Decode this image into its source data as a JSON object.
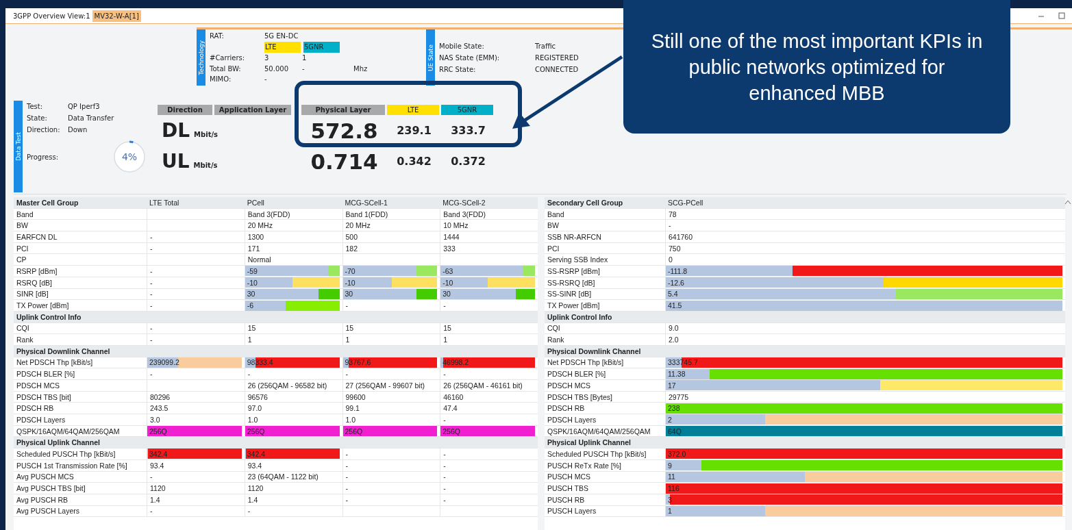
{
  "tabs": [
    {
      "label": "3GPP Overview View:1",
      "selected": false
    },
    {
      "label": "MV32-W-A[1]",
      "selected": true
    }
  ],
  "technology": {
    "title": "Technology",
    "rat_label": "RAT:",
    "rat": "5G EN-DC",
    "badges": [
      {
        "label": "LTE",
        "color": "#ffe000"
      },
      {
        "label": "5GNR",
        "color": "#00b0c8"
      }
    ],
    "rows": [
      {
        "label": "#Carriers:",
        "values": [
          "3",
          "1"
        ]
      },
      {
        "label": "Total BW:",
        "values": [
          "50.000",
          "-",
          "Mhz"
        ]
      },
      {
        "label": "MIMO:",
        "values": [
          "-"
        ]
      }
    ]
  },
  "ue_state": {
    "title": "UE State",
    "rows": [
      {
        "label": "Mobile State:",
        "value": "Traffic"
      },
      {
        "label": "NAS State (EMM):",
        "value": "REGISTERED"
      },
      {
        "label": "RRC State:",
        "value": "CONNECTED"
      }
    ]
  },
  "data_test": {
    "title": "Data Test",
    "rows": [
      {
        "label": "Test:",
        "value": "QP Iperf3"
      },
      {
        "label": "State:",
        "value": "Data Transfer"
      },
      {
        "label": "Direction:",
        "value": "Down"
      }
    ],
    "progress_label": "Progress:",
    "progress": {
      "text": "4%",
      "level": 0.04
    }
  },
  "throughput": {
    "columns": [
      {
        "label": "Direction",
        "color": "#a8a8a8"
      },
      {
        "label": "Application Layer",
        "color": "#a8a8a8"
      },
      {
        "label": "Physical Layer",
        "color": "#a8a8a8"
      },
      {
        "label": "LTE",
        "color": "#ffe000"
      },
      {
        "label": "5GNR",
        "color": "#00b0c8"
      }
    ],
    "rows": [
      {
        "direction": "DL",
        "unit": "Mbit/s",
        "physical": "572.8",
        "lte": "239.1",
        "nr": "333.7"
      },
      {
        "direction": "UL",
        "unit": "Mbit/s",
        "physical": "0.714",
        "lte": "0.342",
        "nr": "0.372"
      }
    ]
  },
  "master_table": {
    "columns": [
      "Master Cell Group",
      "LTE Total",
      "PCell",
      "MCG-SCell-1",
      "MCG-SCell-2"
    ],
    "rows": [
      {
        "kind": "row",
        "label": "Band",
        "cells": [
          null,
          "Band 3(FDD)",
          "Band 1(FDD)",
          "Band 3(FDD)"
        ]
      },
      {
        "kind": "row",
        "label": "BW",
        "cells": [
          null,
          "20 MHz",
          "20 MHz",
          "10 MHz"
        ]
      },
      {
        "kind": "row",
        "label": "EARFCN DL",
        "cells": [
          "-",
          "1300",
          "500",
          "1444"
        ]
      },
      {
        "kind": "row",
        "label": "PCI",
        "cells": [
          "-",
          "171",
          "182",
          "333"
        ]
      },
      {
        "kind": "row",
        "label": "CP",
        "cells": [
          null,
          "Normal",
          null,
          null
        ]
      },
      {
        "kind": "row",
        "label": "RSRP [dBm]",
        "cells": [
          "-",
          {
            "text": "-59",
            "level": 0.88,
            "color": "#99e860"
          },
          {
            "text": "-70",
            "level": 0.78,
            "color": "#99e860"
          },
          {
            "text": "-63",
            "level": 0.87,
            "color": "#99e860"
          }
        ]
      },
      {
        "kind": "row",
        "label": "RSRQ [dB]",
        "cells": [
          "-",
          {
            "text": "-10",
            "level": 0.5,
            "color": "#fde060"
          },
          {
            "text": "-10",
            "level": 0.52,
            "color": "#fde060"
          },
          {
            "text": "-10",
            "level": 0.5,
            "color": "#fde060"
          }
        ]
      },
      {
        "kind": "row",
        "label": "SINR [dB]",
        "cells": [
          "-",
          {
            "text": "30",
            "level": 0.78,
            "color": "#44cc00"
          },
          {
            "text": "30",
            "level": 0.78,
            "color": "#44cc00"
          },
          {
            "text": "30",
            "level": 0.8,
            "color": "#44cc00"
          }
        ]
      },
      {
        "kind": "row",
        "label": "TX Power [dBm]",
        "cells": [
          "-",
          {
            "text": "-6",
            "level": 0.43,
            "color": "#88ee00"
          },
          "-",
          "-"
        ]
      },
      {
        "kind": "section",
        "label": "Uplink Control Info"
      },
      {
        "kind": "row",
        "label": "CQI",
        "cells": [
          "-",
          "15",
          "15",
          "15"
        ]
      },
      {
        "kind": "row",
        "label": "Rank",
        "cells": [
          "-",
          "1",
          "1",
          "1"
        ]
      },
      {
        "kind": "section",
        "label": "Physical Downlink Channel"
      },
      {
        "kind": "row",
        "label": "Net PDSCH Thp [kBit/s]",
        "cells": [
          {
            "text": "239099.2",
            "level": 0.33,
            "color": "#f8cc9c"
          },
          {
            "text": "98333.4",
            "level": 0.11,
            "color": "#f01818"
          },
          {
            "text": "93767.6",
            "level": 0.06,
            "color": "#f01818"
          },
          {
            "text": "46998.2",
            "level": 0.03,
            "color": "#f01818"
          }
        ]
      },
      {
        "kind": "row",
        "label": "PDSCH BLER [%]",
        "cells": [
          "-",
          "-",
          "-",
          "-"
        ]
      },
      {
        "kind": "row",
        "label": "PDSCH MCS",
        "cells": [
          null,
          "26 (256QAM - 96582 bit)",
          "27 (256QAM - 99607 bit)",
          "26 (256QAM - 46161 bit)"
        ]
      },
      {
        "kind": "row",
        "label": "PDSCH TBS [bit]",
        "cells": [
          "80296",
          "96576",
          "99600",
          "46160"
        ]
      },
      {
        "kind": "row",
        "label": "PDSCH RB",
        "cells": [
          "243.5",
          "97.0",
          "99.1",
          "47.4"
        ]
      },
      {
        "kind": "row",
        "label": "PDSCH Layers",
        "cells": [
          "3.0",
          "1.0",
          "1.0",
          "-"
        ]
      },
      {
        "kind": "row",
        "label": "QSPK/16AQM/64QAM/256QAM",
        "cells": [
          {
            "text": "256Q",
            "color": "#f020d0"
          },
          {
            "text": "256Q",
            "color": "#f020d0"
          },
          {
            "text": "256Q",
            "color": "#f020d0"
          },
          {
            "text": "256Q",
            "color": "#f020d0"
          }
        ]
      },
      {
        "kind": "section",
        "label": "Physical Uplink Channel"
      },
      {
        "kind": "row",
        "label": "Scheduled PUSCH Thp [kBit/s]",
        "cells": [
          {
            "text": "342.4",
            "level": 0.01,
            "color": "#f01818"
          },
          {
            "text": "342.4",
            "level": 0.01,
            "color": "#f01818"
          },
          "-",
          "-"
        ]
      },
      {
        "kind": "row",
        "label": "PUSCH 1st Transmission Rate [%]",
        "cells": [
          "93.4",
          "93.4",
          "-",
          "-"
        ]
      },
      {
        "kind": "row",
        "label": "Avg PUSCH MCS",
        "cells": [
          "-",
          "23 (64QAM - 1122 bit)",
          "-",
          "-"
        ]
      },
      {
        "kind": "row",
        "label": "Avg PUSCH TBS [bit]",
        "cells": [
          "1120",
          "1120",
          "-",
          "-"
        ]
      },
      {
        "kind": "row",
        "label": "Avg PUSCH RB",
        "cells": [
          "1.4",
          "1.4",
          "-",
          "-"
        ]
      },
      {
        "kind": "row",
        "label": "Avg PUSCH Layers",
        "cells": [
          "-",
          "-",
          null,
          null
        ]
      }
    ]
  },
  "secondary_table": {
    "columns": [
      "Secondary Cell Group",
      "SCG-PCell"
    ],
    "rows": [
      {
        "kind": "row",
        "label": "Band",
        "cells": [
          "78"
        ]
      },
      {
        "kind": "row",
        "label": "BW",
        "cells": [
          "-"
        ]
      },
      {
        "kind": "row",
        "label": "SSB NR-ARFCN",
        "cells": [
          "641760"
        ]
      },
      {
        "kind": "row",
        "label": "PCI",
        "cells": [
          "750"
        ]
      },
      {
        "kind": "row",
        "label": "Serving SSB Index",
        "cells": [
          "0"
        ]
      },
      {
        "kind": "row",
        "label": "SS-RSRP [dBm]",
        "cells": [
          {
            "text": "-111.8",
            "level": 0.32,
            "color": "#f01818"
          }
        ]
      },
      {
        "kind": "row",
        "label": "SS-RSRQ [dB]",
        "cells": [
          {
            "text": "-12.6",
            "level": 0.55,
            "color": "#ffd800"
          }
        ]
      },
      {
        "kind": "row",
        "label": "SS-SINR [dB]",
        "cells": [
          {
            "text": "5.4",
            "level": 0.58,
            "color": "#99e860"
          }
        ]
      },
      {
        "kind": "row",
        "label": "TX Power [dBm]",
        "cells": [
          {
            "text": "41.5",
            "color": "#b4c6e0"
          }
        ]
      },
      {
        "kind": "section",
        "label": "Uplink Control Info"
      },
      {
        "kind": "row",
        "label": "CQI",
        "cells": [
          "9.0"
        ]
      },
      {
        "kind": "row",
        "label": "Rank",
        "cells": [
          "2.0"
        ]
      },
      {
        "kind": "section",
        "label": "Physical Downlink Channel"
      },
      {
        "kind": "row",
        "label": "Net PDSCH Thp [kBit/s]",
        "cells": [
          {
            "text": "333745.7",
            "level": 0.04,
            "color": "#f01818"
          }
        ]
      },
      {
        "kind": "row",
        "label": "PDSCH BLER [%]",
        "cells": [
          {
            "text": "11.38",
            "level": 0.11,
            "color": "#66e000"
          }
        ]
      },
      {
        "kind": "row",
        "label": "PDSCH MCS",
        "cells": [
          {
            "text": "17",
            "level": 0.54,
            "color": "#fde868"
          }
        ]
      },
      {
        "kind": "row",
        "label": "PDSCH TBS [Bytes]",
        "cells": [
          "29775"
        ]
      },
      {
        "kind": "row",
        "label": "PDSCH RB",
        "cells": [
          {
            "text": "238",
            "color": "#66e000"
          }
        ]
      },
      {
        "kind": "row",
        "label": "PDSCH Layers",
        "cells": [
          {
            "text": "2",
            "level": 0.25,
            "color": "#f8cc9c"
          }
        ]
      },
      {
        "kind": "row",
        "label": "QSPK/16AQM/64QAM/256QAM",
        "cells": [
          {
            "text": "64Q",
            "color": "#008098"
          }
        ]
      },
      {
        "kind": "section",
        "label": "Physical Uplink Channel"
      },
      {
        "kind": "row",
        "label": "Scheduled PUSCH Thp [kBit/s]",
        "cells": [
          {
            "text": "372.0",
            "color": "#f01818"
          }
        ]
      },
      {
        "kind": "row",
        "label": "PUSCH ReTx Rate [%]",
        "cells": [
          {
            "text": "9",
            "level": 0.09,
            "color": "#66e000"
          }
        ]
      },
      {
        "kind": "row",
        "label": "PUSCH MCS",
        "cells": [
          {
            "text": "11",
            "level": 0.35,
            "color": "#f8cc9c"
          }
        ]
      },
      {
        "kind": "row",
        "label": "PUSCH TBS",
        "cells": [
          {
            "text": "116",
            "color": "#f01818"
          }
        ]
      },
      {
        "kind": "row",
        "label": "PUSCH RB",
        "cells": [
          {
            "text": "3",
            "level": 0.01,
            "color": "#f01818"
          }
        ]
      },
      {
        "kind": "row",
        "label": "PUSCH Layers",
        "cells": [
          {
            "text": "1",
            "level": 0.25,
            "color": "#f8cc9c"
          }
        ]
      }
    ]
  },
  "callout": {
    "text": "Still one of the most important KPIs in public networks optimized for enhanced MBB"
  }
}
